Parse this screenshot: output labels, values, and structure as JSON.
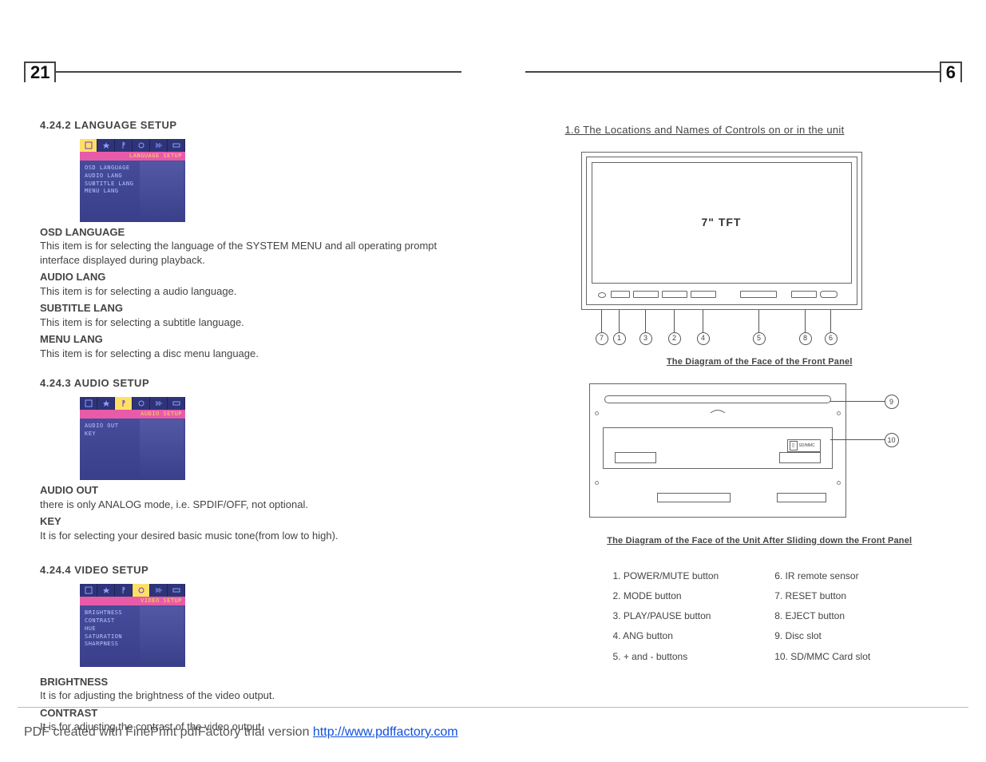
{
  "left_page_number": "21",
  "right_page_number": "6",
  "s4242": {
    "heading": "4.24.2  LANGUAGE SETUP",
    "osd_title": "LANGUAGE SETUP",
    "osd_items": [
      "OSD LANGUAGE",
      "AUDIO LANG",
      "SUBTITLE LANG",
      "MENU LANG"
    ],
    "h1": "OSD LANGUAGE",
    "t1": "This item is for selecting the language of the SYSTEM MENU and all operating prompt interface displayed during playback.",
    "h2": "AUDIO LANG",
    "t2": "This item is for selecting a audio language.",
    "h3": "SUBTITLE LANG",
    "t3": "This item is for selecting a subtitle language.",
    "h4": "MENU LANG",
    "t4": "This item is for selecting a disc menu language."
  },
  "s4243": {
    "heading": "4.24.3  AUDIO SETUP",
    "osd_title": "AUDIO SETUP",
    "osd_items": [
      "AUDIO OUT",
      "KEY"
    ],
    "h1": "AUDIO OUT",
    "t1": "there is only ANALOG mode, i.e. SPDIF/OFF, not optional.",
    "h2": "KEY",
    "t2": "It is for selecting your desired basic music tone(from low to high)."
  },
  "s4244": {
    "heading": "4.24.4  VIDEO SETUP",
    "osd_title": "VIDEO SETUP",
    "osd_items": [
      "BRIGHTNESS",
      "CONTRAST",
      "HUE",
      "SATURATION",
      "SHARPNESS"
    ],
    "h1": "BRIGHTNESS",
    "t1": "It is for adjusting the brightness of the video output.",
    "h2": "CONTRAST",
    "t2": "It is for adjusting the contrast of the video output."
  },
  "right": {
    "section_title": "1.6  The Locations and Names of Controls on or in the unit",
    "screen_label": "7\" TFT",
    "caption1": "The Diagram of the Face of the Front Panel",
    "caption2": "The Diagram of the Face of the Unit After Sliding down the Front Panel",
    "sd_label": "SD/MMC",
    "controls_left": [
      "1. POWER/MUTE button",
      "2. MODE button",
      "3. PLAY/PAUSE button",
      "4. ANG button",
      "5. + and - buttons"
    ],
    "controls_right": [
      "6. IR remote sensor",
      "7. RESET button",
      "8. EJECT button",
      "9. Disc slot",
      "10. SD/MMC Card slot"
    ]
  },
  "footer": {
    "text": "PDF created with FinePrint pdfFactory trial version ",
    "link": "http://www.pdffactory.com"
  }
}
